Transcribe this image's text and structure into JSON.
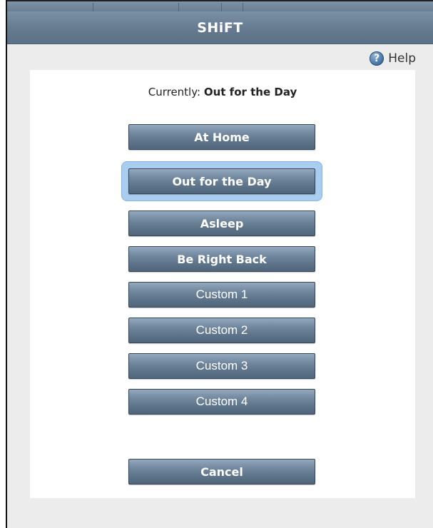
{
  "window": {
    "title": "SHiFT"
  },
  "help": {
    "label": "Help",
    "icon": "question-mark-icon"
  },
  "status": {
    "prefix": "Currently:",
    "value": "Out for the Day"
  },
  "buttons": {
    "at_home": "At Home",
    "out_for_the_day": "Out for the Day",
    "asleep": "Asleep",
    "be_right_back": "Be Right Back",
    "custom_1": "Custom 1",
    "custom_2": "Custom 2",
    "custom_3": "Custom 3",
    "custom_4": "Custom 4",
    "cancel": "Cancel"
  },
  "colors": {
    "titlebar": "#64798e",
    "button": "#6a8097",
    "selection_highlight": "#a9cdef"
  }
}
